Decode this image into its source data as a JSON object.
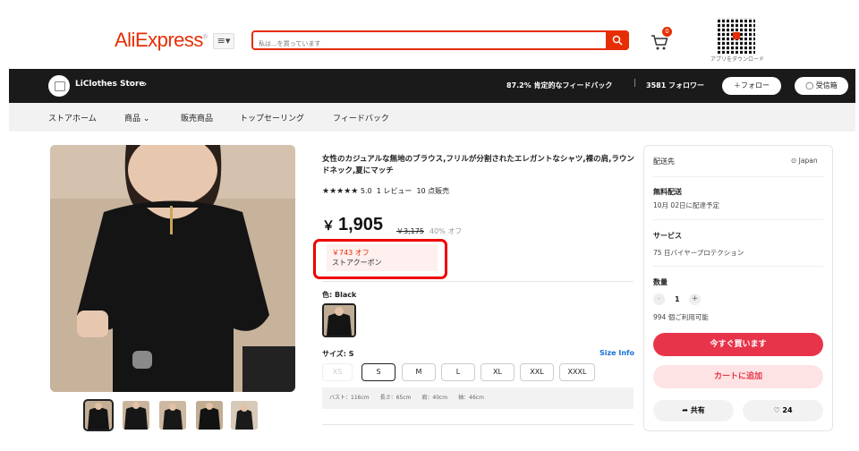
{
  "header": {
    "logo": "AliExpress",
    "logo_mark": "®",
    "menu_icon": "≡▾",
    "search_placeholder": "私は...を買っています",
    "cart_count": "0",
    "qr_caption": "アプリをダウンロード"
  },
  "store": {
    "name": "LiClothes Store",
    "feedback": "87.2% 肯定的なフィードバック",
    "divider": "|",
    "followers": "3581 フォロワー",
    "follow_label": "＋フォロー",
    "message_label": "受信箱"
  },
  "store_nav": [
    "ストアホーム",
    "商品",
    "販売商品",
    "トップセーリング",
    "フィードバック"
  ],
  "product": {
    "title": "女性のカジュアルな無地のブラウス,フリルが分割されたエレガントなシャツ,裸の肩,ラウンドネック,夏にマッチ",
    "stars": "★★★★★",
    "rating": "5.0",
    "reviews": "1 レビュー",
    "sold": "10 点販売",
    "currency": "￥",
    "price": "1,905",
    "original_price": "￥3,175",
    "discount": "40% オフ",
    "coupon_amount": "￥743 オフ",
    "coupon_label": "ストアクーポン",
    "color_label": "色: Black",
    "size_label": "サイズ: S",
    "size_info": "Size Info",
    "sizes": [
      "XS",
      "S",
      "M",
      "L",
      "XL",
      "XXL",
      "XXXL"
    ],
    "selected_size": "S",
    "measurements": "バスト：116cm　　長さ：65cm　　肩：40cm　　袖：46cm"
  },
  "panel": {
    "ship_to_label": "配送先",
    "ship_to_value": "Japan",
    "shipping_title": "無料配送",
    "shipping_date": "10月 02日に配達予定",
    "service_title": "サービス",
    "service_value": "75 日バイヤープロテクション",
    "qty_title": "数量",
    "qty_value": "1",
    "qty_minus": "-",
    "qty_plus": "+",
    "stock": "994 個ご利用可能",
    "buy_now": "今すぐ買います",
    "add_to_cart": "カートに追加",
    "share": "共有",
    "favorites": "24"
  },
  "colors": {
    "brand": "#e62e04",
    "buy_button": "#e8344a",
    "cart_button_bg": "#fde3e3",
    "highlight": "#e00000",
    "link": "#1a6fd6"
  },
  "icons": [
    "search-icon",
    "cart-icon",
    "qr-code-icon",
    "store-icon",
    "chevron-right-icon",
    "chat-icon",
    "chevron-down-icon",
    "location-icon",
    "share-icon",
    "heart-icon"
  ]
}
